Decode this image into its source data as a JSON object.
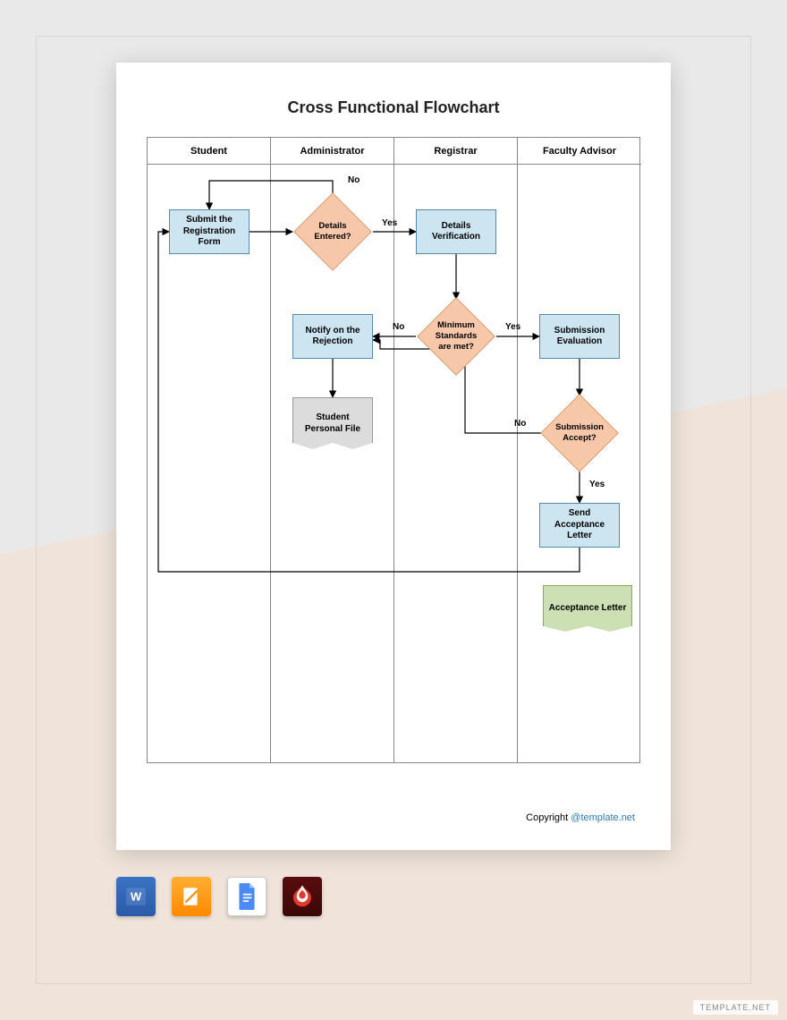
{
  "title": "Cross Functional Flowchart",
  "lanes": [
    "Student",
    "Administrator",
    "Registrar",
    "Faculty Advisor"
  ],
  "nodes": {
    "submit": "Submit the Registration Form",
    "details_entered": "Details Entered?",
    "details_verification": "Details Verification",
    "min_standards": "Minimum Standards are met?",
    "notify_rejection": "Notify on the Rejection",
    "submission_eval": "Submission Evaluation",
    "student_file": "Student Personal File",
    "submission_accept": "Submission Accept?",
    "send_accept": "Send Acceptance Letter",
    "acceptance_letter": "Acceptance Letter"
  },
  "labels": {
    "yes": "Yes",
    "no": "No"
  },
  "copyright": {
    "prefix": "Copyright ",
    "link": "@template.net"
  },
  "formats": [
    "word",
    "pages",
    "gdocs",
    "pdf"
  ],
  "watermark": "TEMPLATE.NET"
}
